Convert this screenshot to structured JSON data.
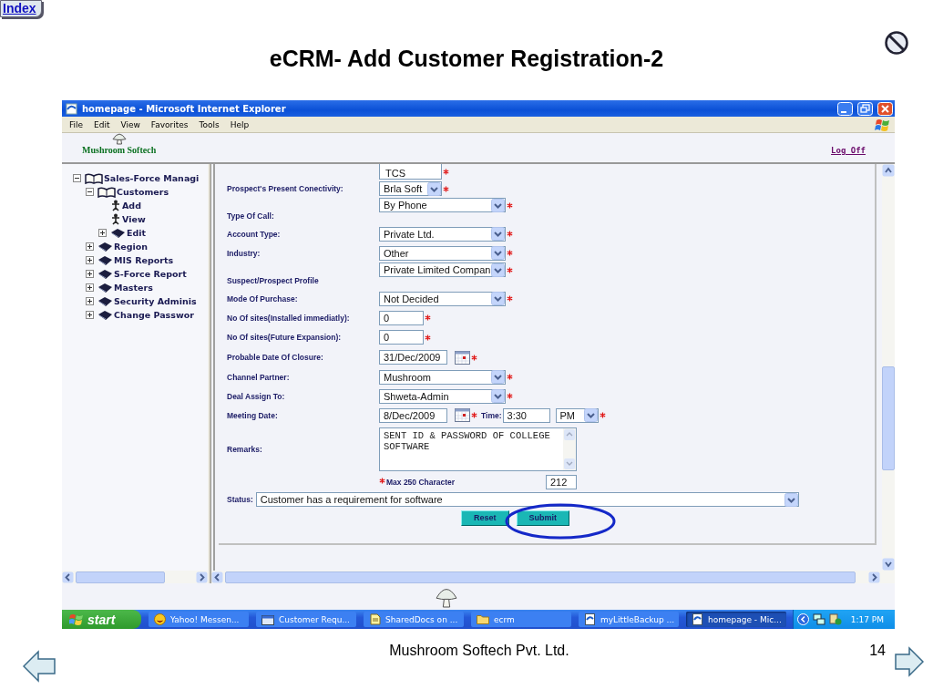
{
  "slide": {
    "index_link": "Index",
    "title": "eCRM- Add Customer Registration-2",
    "footer": "Mushroom Softech Pvt. Ltd.",
    "page_number": "14"
  },
  "window": {
    "title": "homepage - Microsoft Internet Explorer",
    "menu": [
      "File",
      "Edit",
      "View",
      "Favorites",
      "Tools",
      "Help"
    ]
  },
  "header": {
    "logo_text": "Mushroom Softech",
    "logoff": "Log Off"
  },
  "tree": [
    {
      "label": "Sales-Force Managi",
      "kind": "open-book",
      "expanded": true,
      "children": [
        {
          "label": "Customers",
          "kind": "open-book",
          "expanded": true,
          "children": [
            {
              "label": "Add",
              "kind": "figure"
            },
            {
              "label": "View",
              "kind": "figure"
            },
            {
              "label": "Edit",
              "kind": "book",
              "expanded": false
            }
          ]
        },
        {
          "label": "Region",
          "kind": "book",
          "expanded": false
        },
        {
          "label": "MIS Reports",
          "kind": "book",
          "expanded": false
        },
        {
          "label": "S-Force Report",
          "kind": "book",
          "expanded": false
        },
        {
          "label": "Masters",
          "kind": "book",
          "expanded": false
        },
        {
          "label": "Security Adminis",
          "kind": "book",
          "expanded": false
        },
        {
          "label": "Change Passwor",
          "kind": "book",
          "expanded": false
        }
      ]
    }
  ],
  "form": {
    "rows": [
      {
        "kind": "listbox",
        "value": "TCS",
        "required": true
      },
      {
        "kind": "compact-select",
        "label": "Prospect's Present Conectivity:",
        "value": "Brla Soft",
        "required": true
      },
      {
        "kind": "select",
        "label": "Type Of Call:",
        "value": "By Phone",
        "required": true
      },
      {
        "kind": "select",
        "label": "Account Type:",
        "value": "Private Ltd.",
        "required": true
      },
      {
        "kind": "select",
        "label": "Industry:",
        "value": "Other",
        "required": true
      },
      {
        "kind": "select",
        "label": "Suspect/Prospect Profile",
        "value": "Private Limited Compan",
        "required": true
      },
      {
        "kind": "select",
        "label": "Mode Of Purchase:",
        "value": "Not Decided",
        "required": true
      },
      {
        "kind": "text",
        "label": "No Of sites(Installed immediatly):",
        "value": "0",
        "required": true
      },
      {
        "kind": "text",
        "label": "No Of sites(Future Expansion):",
        "value": "0",
        "required": true
      },
      {
        "kind": "date",
        "label": "Probable Date Of Closure:",
        "value": "31/Dec/2009",
        "required": true
      },
      {
        "kind": "select",
        "label": "Channel Partner:",
        "value": "Mushroom",
        "required": true
      },
      {
        "kind": "select",
        "label": "Deal Assign To:",
        "value": "Shweta-Admin",
        "required": true
      },
      {
        "kind": "datetime",
        "label": "Meeting Date:",
        "value": "8/Dec/2009",
        "time_label": "Time:",
        "time": "3:30",
        "period": "PM",
        "required": true
      },
      {
        "kind": "textarea",
        "label": "Remarks:",
        "value": "SENT ID & PASSWORD OF COLLEGE SOFTWARE",
        "required": true,
        "note": "Max 250 Character",
        "count": "212"
      }
    ],
    "status": {
      "label": "Status:",
      "value": "Customer has a requirement for software"
    },
    "buttons": [
      {
        "label": "Reset",
        "circled": false
      },
      {
        "label": "Submit",
        "circled": true
      }
    ]
  },
  "taskbar": {
    "start": "start",
    "items": [
      {
        "label": "Yahoo! Messen...",
        "kind": "smiley",
        "selected": false
      },
      {
        "label": "Customer Requ...",
        "kind": "window",
        "selected": false
      },
      {
        "label": "SharedDocs on ...",
        "kind": "document",
        "selected": false
      },
      {
        "label": "ecrm",
        "kind": "folder",
        "selected": false
      },
      {
        "label": "myLittleBackup ...",
        "kind": "page",
        "selected": false
      },
      {
        "label": "homepage - Mic...",
        "kind": "page",
        "selected": true
      }
    ],
    "clock": "1:17 PM"
  }
}
